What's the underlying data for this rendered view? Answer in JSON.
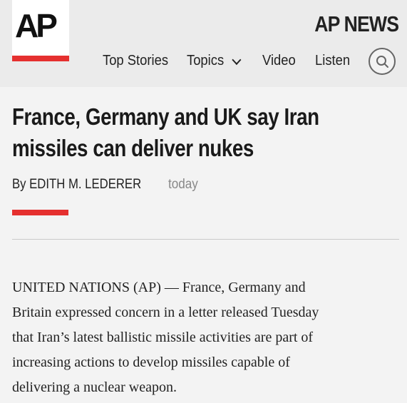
{
  "brand": {
    "logo_text": "AP",
    "name": "AP NEWS"
  },
  "nav": {
    "items": [
      {
        "label": "Top Stories"
      },
      {
        "label": "Topics"
      },
      {
        "label": "Video"
      },
      {
        "label": "Listen"
      }
    ],
    "search_icon": "search-icon",
    "topics_icon": "chevron-down-icon"
  },
  "article": {
    "headline_line1": "France, Germany and UK say Iran",
    "headline_line2": "missiles can deliver nukes",
    "byline": "By EDITH M. LEDERER",
    "date": "today",
    "body_lines": [
      "UNITED NATIONS (AP) — France, Germany and",
      "Britain expressed concern in a letter released Tuesday",
      "that Iran’s latest ballistic missile activities are part of",
      "increasing actions to develop missiles capable of",
      "delivering a nuclear weapon."
    ]
  },
  "colors": {
    "accent": "#e5302f",
    "header_bg": "#ebebeb",
    "page_bg": "#f3f3f3"
  }
}
